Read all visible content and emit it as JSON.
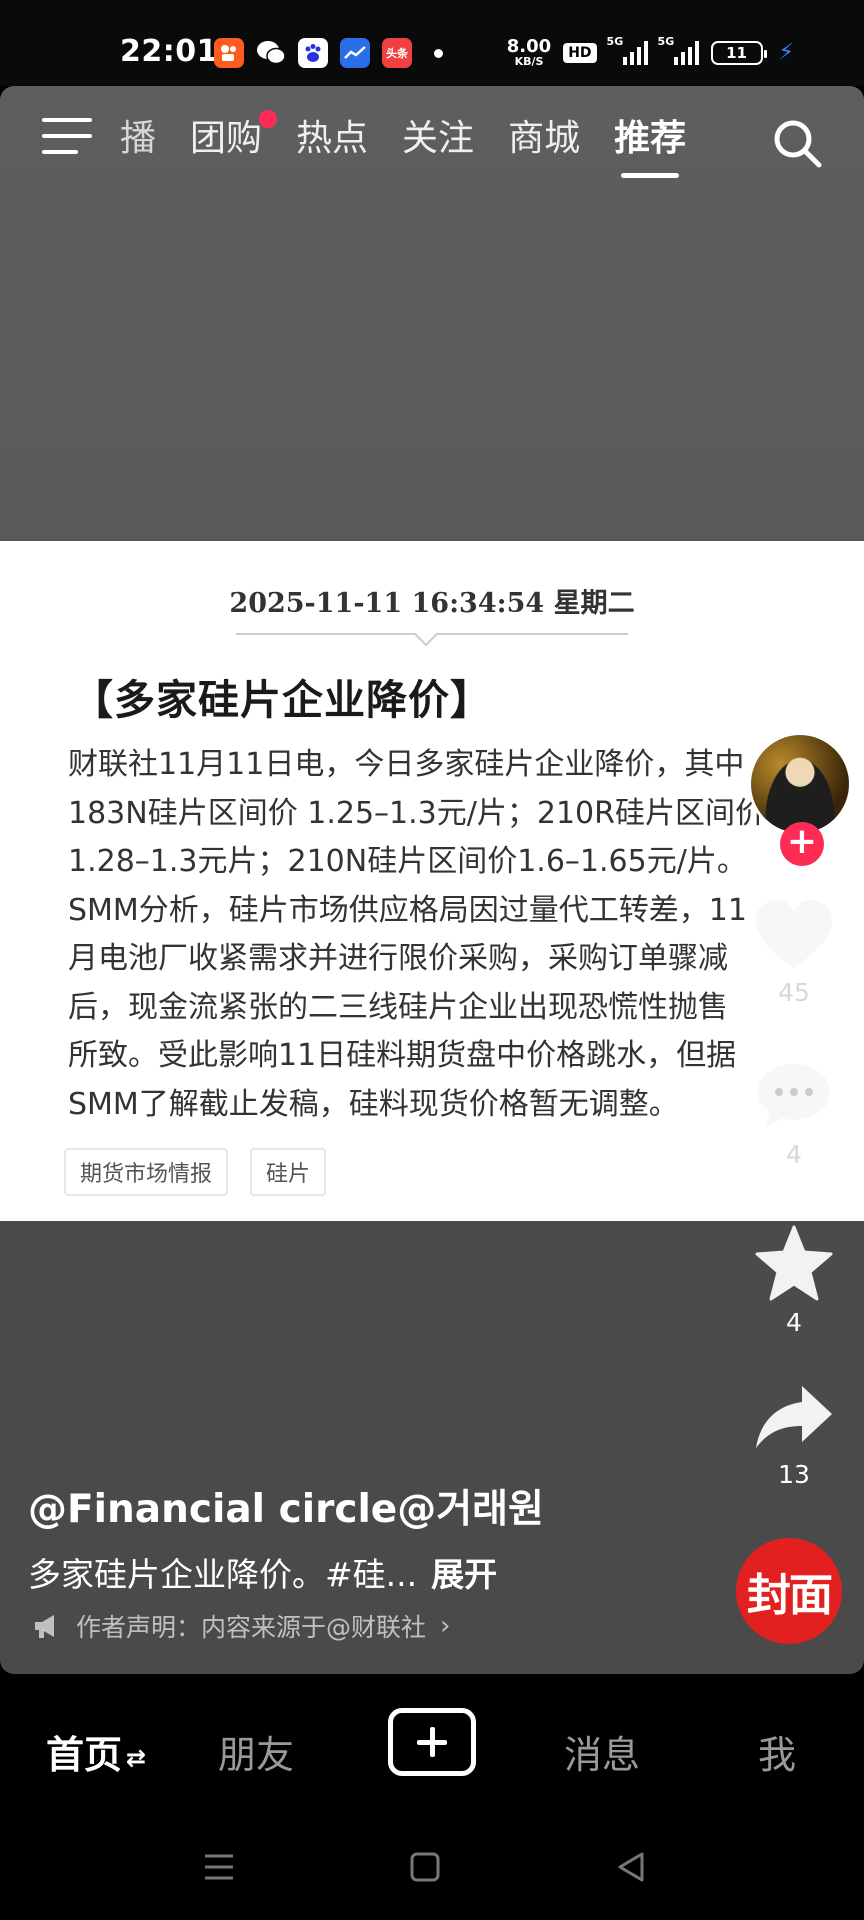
{
  "status_bar": {
    "time": "22:01",
    "net_speed_value": "8.00",
    "net_speed_unit": "KB/S",
    "hd_label": "HD",
    "signal_1_label": "5G",
    "signal_2_label": "5G",
    "battery_level": "11",
    "app_icons": [
      "kuaishou-icon",
      "wechat-icon",
      "baidu-icon",
      "stock-app-icon",
      "toutiao-icon"
    ],
    "toutiao_label": "头条"
  },
  "top_nav": {
    "tabs": [
      {
        "label": "播",
        "active": false
      },
      {
        "label": "团购",
        "active": false,
        "badge": true
      },
      {
        "label": "热点",
        "active": false
      },
      {
        "label": "关注",
        "active": false
      },
      {
        "label": "商城",
        "active": false
      },
      {
        "label": "推荐",
        "active": true
      }
    ]
  },
  "news_card": {
    "date": "2025-11-11 16:34:54 星期二",
    "title": "【多家硅片企业降价】",
    "body_lines": [
      "财联社11月11日电，今日多家硅片企业降价，其中",
      "183N硅片区间价 1.25–1.3元/片；210R硅片区间价",
      "1.28–1.3元片；210N硅片区间价1.6–1.65元/片。",
      "SMM分析，硅片市场供应格局因过量代工转差，11",
      "月电池厂收紧需求并进行限价采购，采购订单骤减",
      "后，现金流紧张的二三线硅片企业出现恐慌性抛售",
      "所致。受此影响11日硅料期货盘中价格跳水，但据",
      "SMM了解截止发稿，硅料现货价格暂无调整。"
    ],
    "tags": [
      "期货市场情报",
      "硅片"
    ]
  },
  "right_rail": {
    "likes": "45",
    "comments": "4",
    "favorites": "4",
    "shares": "13"
  },
  "video_info": {
    "author": "@Financial circle@거래원",
    "caption": "多家硅片企业降价。#硅...",
    "expand_label": "展开",
    "disclaimer": "作者声明：内容来源于@财联社",
    "cover_badge": "封面"
  },
  "bottom_tabs": {
    "home": "首页",
    "home_switch": "⇄",
    "friends": "朋友",
    "messages": "消息",
    "me": "我"
  },
  "colors": {
    "accent_red": "#fe2c55",
    "cover_red": "#e1201f",
    "charging_blue": "#3b82f6"
  }
}
